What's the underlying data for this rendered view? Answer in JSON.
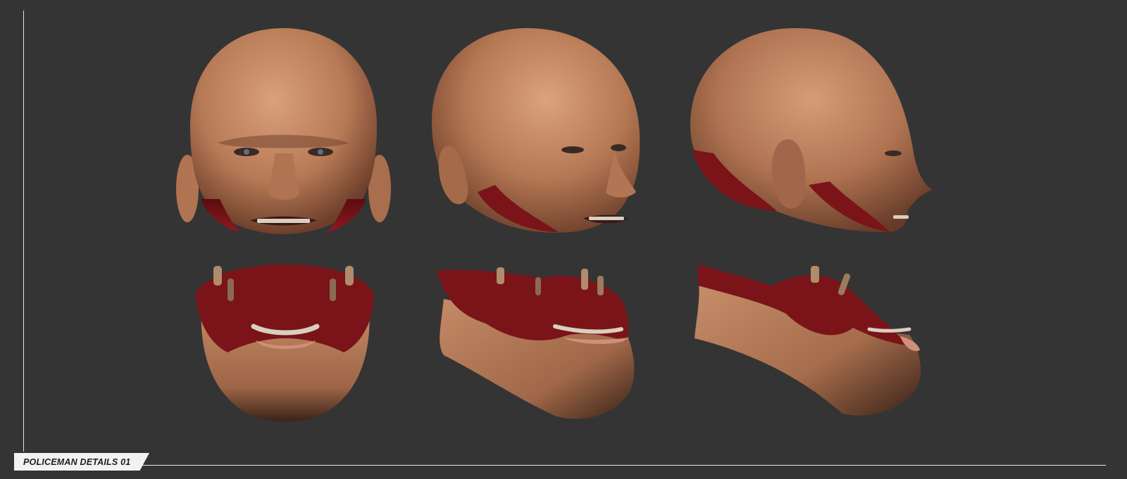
{
  "caption": {
    "label": "POLICEMAN DETAILS 01"
  },
  "colors": {
    "background": "#343434",
    "frame_line": "#e6e6e6",
    "label_plate": "#f2f2f2",
    "skin": "#c48a66",
    "skin_shadow": "#7a4a34",
    "flesh_wound": "#7a1418",
    "teeth": "#d9cfc0"
  },
  "views": {
    "head_front": "bald head front view",
    "head_three_quarter": "bald head three-quarter view",
    "head_profile": "bald head side profile view",
    "jaw_front": "lower jaw front view",
    "jaw_three_quarter": "lower jaw three-quarter view",
    "jaw_profile": "lower jaw side view"
  }
}
